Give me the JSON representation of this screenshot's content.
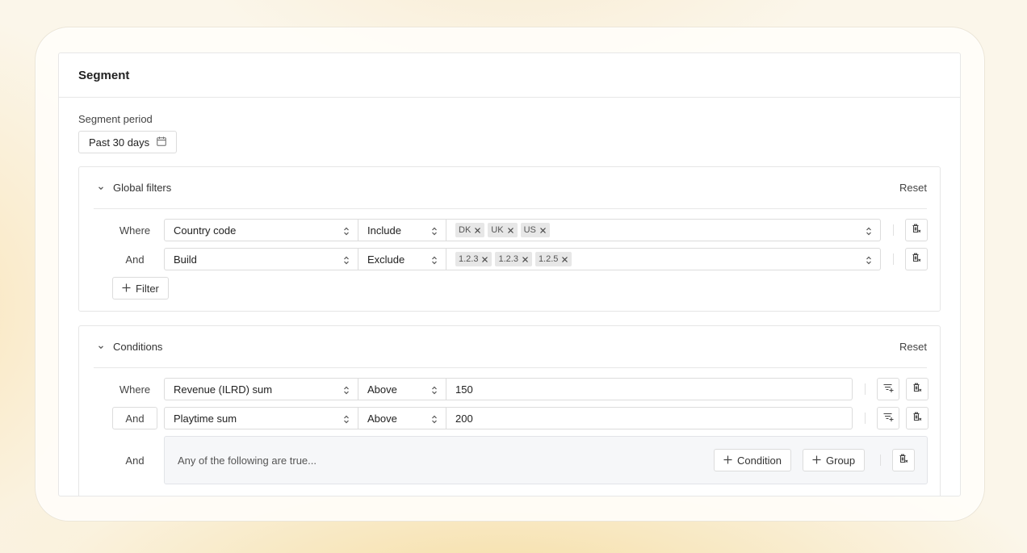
{
  "card": {
    "title": "Segment"
  },
  "period": {
    "label": "Segment period",
    "value": "Past 30 days"
  },
  "global_filters": {
    "title": "Global filters",
    "reset_label": "Reset",
    "rows": [
      {
        "conjunction": "Where",
        "field": "Country code",
        "operator": "Include",
        "tags": [
          "DK",
          "UK",
          "US"
        ]
      },
      {
        "conjunction": "And",
        "field": "Build",
        "operator": "Exclude",
        "tags": [
          "1.2.3",
          "1.2.3",
          "1.2.5"
        ]
      }
    ],
    "add_label": "Filter"
  },
  "conditions": {
    "title": "Conditions",
    "reset_label": "Reset",
    "rows": [
      {
        "conjunction": "Where",
        "field": "Revenue (ILRD) sum",
        "operator": "Above",
        "value": "150"
      },
      {
        "conjunction": "And",
        "field": "Playtime sum",
        "operator": "Above",
        "value": "200"
      }
    ],
    "group": {
      "conjunction": "And",
      "text": "Any of the following are true...",
      "add_condition_label": "Condition",
      "add_group_label": "Group"
    }
  },
  "icons": {
    "chevron": "chevron-down-icon",
    "calendar": "calendar-icon",
    "updown": "chevron-updown-icon",
    "tag_close": "close-icon",
    "plus": "plus-icon",
    "delete": "trash-icon",
    "add_filter": "filter-add-icon"
  }
}
